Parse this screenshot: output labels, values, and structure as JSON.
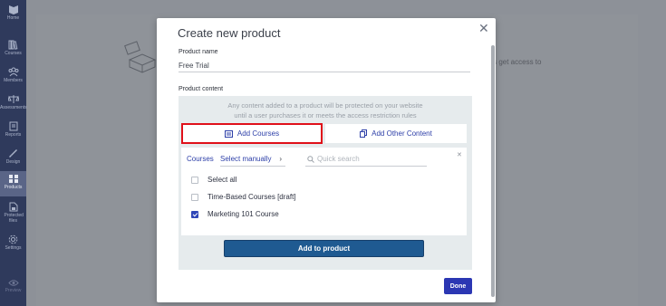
{
  "sidebar": {
    "items": [
      {
        "label": "Home"
      },
      {
        "label": "Courses"
      },
      {
        "label": "Members"
      },
      {
        "label": "Assessments"
      },
      {
        "label": "Reports"
      },
      {
        "label": "Design"
      },
      {
        "label": "Products"
      },
      {
        "label": "Protected files"
      },
      {
        "label": "Settings"
      },
      {
        "label": "Preview"
      }
    ],
    "active": "Products"
  },
  "background": {
    "text": "ers get access to"
  },
  "modal": {
    "title": "Create new product",
    "product_name_label": "Product name",
    "product_name_value": "Free Trial",
    "product_content_label": "Product content",
    "info_line1": "Any content added to a product will be protected on your website",
    "info_line2": "until a user purchases it or meets the access restriction rules",
    "add_courses_label": "Add Courses",
    "add_other_label": "Add Other Content",
    "courses_tab": "Courses",
    "select_mode": "Select manually",
    "search_placeholder": "Quick search",
    "items": [
      {
        "label": "Select all",
        "checked": false
      },
      {
        "label": "Time-Based Courses [draft]",
        "checked": false
      },
      {
        "label": "Marketing 101 Course",
        "checked": true
      }
    ],
    "add_to_product_label": "Add to product",
    "done_label": "Done"
  }
}
